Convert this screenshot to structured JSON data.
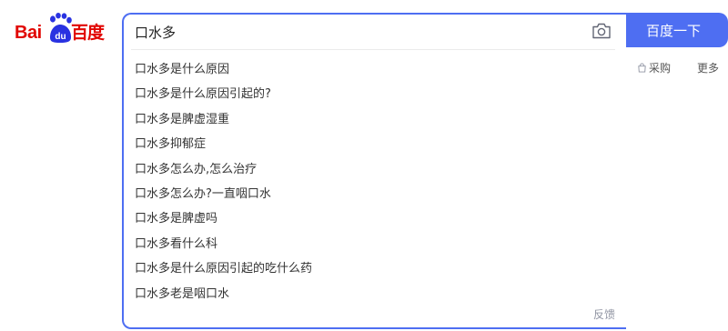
{
  "logo": {
    "text_latin": "Bai",
    "text_chinese": "百度",
    "paw_text": "du",
    "brand_red": "#e10602",
    "brand_blue": "#2932e1"
  },
  "search": {
    "query": "口水多",
    "camera_icon": "camera-icon",
    "button_label": "百度一下",
    "accent": "#4e6ef2"
  },
  "suggestions": [
    "口水多是什么原因",
    "口水多是什么原因引起的?",
    "口水多是脾虚湿重",
    "口水多抑郁症",
    "口水多怎么办,怎么治疗",
    "口水多怎么办?一直咽口水",
    "口水多是脾虚吗",
    "口水多看什么科",
    "口水多是什么原因引起的吃什么药",
    "口水多老是咽口水"
  ],
  "feedback_label": "反馈",
  "right_links": {
    "caigou": "采购",
    "caigou_icon": "shopping-bag-icon",
    "gengduo": "更多"
  }
}
